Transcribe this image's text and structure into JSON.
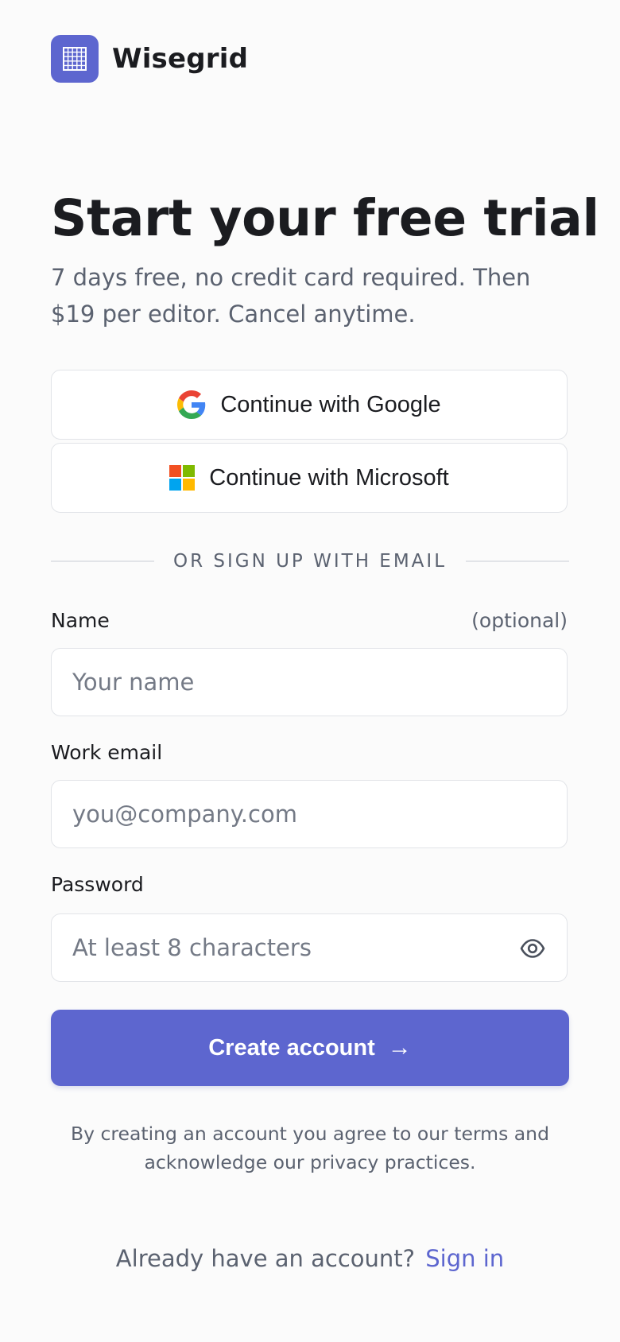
{
  "brand": {
    "name": "Wisegrid",
    "logo_icon": "grid-icon",
    "accent_color": "#5d66cf"
  },
  "hero": {
    "title": "Start your free trial",
    "subtitle": "7 days free, no credit card required. Then $19 per editor. Cancel anytime."
  },
  "sso": {
    "google_label": "Continue with Google",
    "google_icon": "google-icon",
    "microsoft_label": "Continue with Microsoft",
    "microsoft_icon": "microsoft-icon"
  },
  "divider": {
    "text": "OR SIGN UP WITH EMAIL"
  },
  "form": {
    "name": {
      "label": "Name",
      "hint": "(optional)",
      "placeholder": "Your name",
      "value": ""
    },
    "email": {
      "label": "Work email",
      "placeholder": "you@company.com",
      "value": ""
    },
    "password": {
      "label": "Password",
      "placeholder": "At least 8 characters",
      "value": "",
      "toggle_icon": "eye-icon"
    },
    "submit_label": "Create account",
    "submit_arrow": "→"
  },
  "legal": {
    "text": "By creating an account you agree to our terms and acknowledge our privacy practices."
  },
  "footer": {
    "prompt": "Already have an account?",
    "link_label": "Sign in"
  }
}
